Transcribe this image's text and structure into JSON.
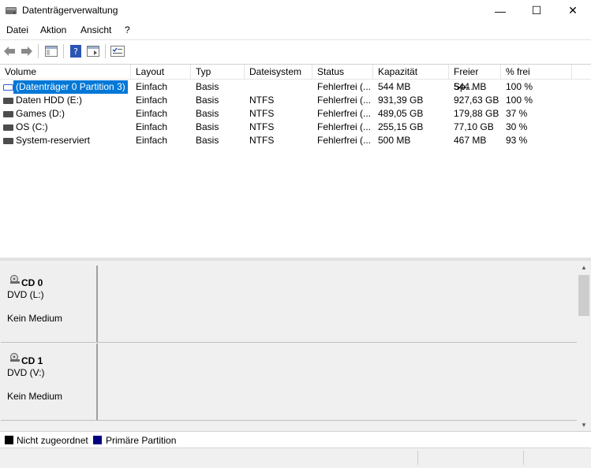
{
  "window": {
    "title": "Datenträgerverwaltung",
    "minimize": "—",
    "maximize": "☐",
    "close": "✕"
  },
  "menu": {
    "items": [
      "Datei",
      "Aktion",
      "Ansicht",
      "?"
    ]
  },
  "toolbar": {
    "buttons": [
      "back-icon",
      "forward-icon",
      "console-tree-icon",
      "help-icon",
      "properties-icon",
      "disk-list-icon"
    ]
  },
  "volume_list": {
    "columns": [
      "Volume",
      "Layout",
      "Typ",
      "Dateisystem",
      "Status",
      "Kapazität",
      "Freier Sp...",
      "% frei"
    ],
    "rows": [
      {
        "volume": "(Datenträger 0 Partition 3)",
        "layout": "Einfach",
        "typ": "Basis",
        "dateisystem": "",
        "status": "Fehlerfrei (...",
        "kapazitaet": "544 MB",
        "frei": "544 MB",
        "prozent": "100 %"
      },
      {
        "volume": "Daten HDD (E:)",
        "layout": "Einfach",
        "typ": "Basis",
        "dateisystem": "NTFS",
        "status": "Fehlerfrei (...",
        "kapazitaet": "931,39 GB",
        "frei": "927,63 GB",
        "prozent": "100 %"
      },
      {
        "volume": "Games (D:)",
        "layout": "Einfach",
        "typ": "Basis",
        "dateisystem": "NTFS",
        "status": "Fehlerfrei (...",
        "kapazitaet": "489,05 GB",
        "frei": "179,88 GB",
        "prozent": "37 %"
      },
      {
        "volume": "OS (C:)",
        "layout": "Einfach",
        "typ": "Basis",
        "dateisystem": "NTFS",
        "status": "Fehlerfrei (...",
        "kapazitaet": "255,15 GB",
        "frei": "77,10 GB",
        "prozent": "30 %"
      },
      {
        "volume": "System-reserviert",
        "layout": "Einfach",
        "typ": "Basis",
        "dateisystem": "NTFS",
        "status": "Fehlerfrei (...",
        "kapazitaet": "500 MB",
        "frei": "467 MB",
        "prozent": "93 %"
      }
    ]
  },
  "disks": [
    {
      "name": "CD 0",
      "type": "DVD (L:)",
      "status": "Kein Medium"
    },
    {
      "name": "CD 1",
      "type": "DVD (V:)",
      "status": "Kein Medium"
    }
  ],
  "legend": [
    {
      "label": "Nicht zugeordnet",
      "color": "#000000"
    },
    {
      "label": "Primäre Partition",
      "color": "#000080"
    }
  ],
  "colors": {
    "selection": "#0078d7",
    "unallocated": "#000000",
    "primary_partition": "#000080"
  }
}
